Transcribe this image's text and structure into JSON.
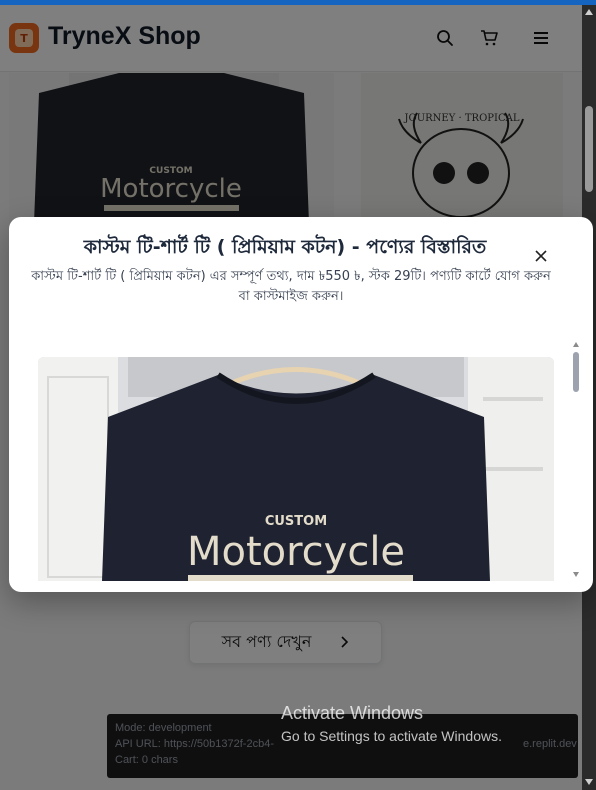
{
  "header": {
    "brand": "TryneX Shop",
    "logo_letter": "T",
    "icons": [
      "search-icon",
      "cart-icon",
      "menu-icon"
    ]
  },
  "product_cards": [
    {
      "shirt_text_top": "CUSTOM",
      "shirt_text_main": "Motorcycle",
      "shirt_color": "#22252b"
    },
    {
      "shirt_text_top": "JOURNEY · TROPICAL",
      "shirt_color": "#efeeea"
    }
  ],
  "view_all": {
    "label": "সব পণ্য দেখুন",
    "icon": "chevron-right-icon"
  },
  "dev_panel": {
    "mode": "Mode: development",
    "api": "API URL: https://50b1372f-2cb4-",
    "api_tail": "e.replit.dev",
    "cart": "Cart: 0 chars"
  },
  "modal": {
    "title": "কাস্টম টি-শার্ট টি ( প্রিমিয়াম কটন) - পণ্যের বিস্তারিত",
    "description": "কাস্টম টি-শার্ট টি ( প্রিমিয়াম কটন) এর সম্পূর্ণ তথ্য, দাম ৳550 ৳, স্টক 29টি। পণ্যটি কার্টে যোগ করুন বা কাস্টমাইজ করুন।",
    "close_icon": "close-icon",
    "image": {
      "text_top": "CUSTOM",
      "text_main": "Motorcycle",
      "shirt_color": "#1f2230"
    }
  },
  "watermark": {
    "title": "Activate Windows",
    "subtitle": "Go to Settings to activate Windows."
  },
  "colors": {
    "accent": "#1565c0",
    "brand": "#f06b1e",
    "overlay": "rgba(0,0,0,0.5)"
  }
}
